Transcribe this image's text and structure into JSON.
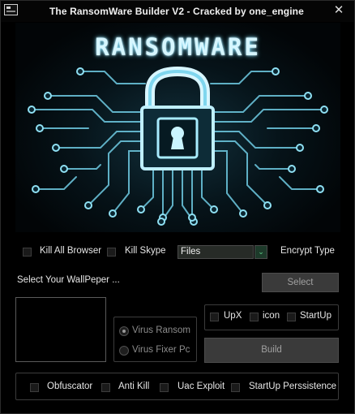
{
  "window": {
    "title": "The RansomWare Builder V2 - Cracked by one_engine",
    "close_glyph": "✕"
  },
  "banner": {
    "title": "RANSOMWARE"
  },
  "options_row": {
    "kill_all_browser": "Kill All Browser",
    "kill_skype": "Kill Skype",
    "file_type_value": "Files",
    "dropdown_arrow": "⌄",
    "encrypt_type": "Encrypt Type"
  },
  "wallpaper": {
    "label": "Select Your WallPeper ...",
    "select_button": "Select"
  },
  "mode": {
    "virus_ransom": "Virus Ransom",
    "virus_fixer": "Virus Fixer Pc",
    "selected": "Virus Ransom"
  },
  "packing": {
    "upx": "UpX",
    "icon": "icon",
    "startup": "StartUp"
  },
  "build_button": "Build",
  "bottom_options": {
    "obfuscator": "Obfuscator",
    "anti_kill": "Anti Kill",
    "uac_exploit": "Uac Exploit",
    "startup_persistence": "StartUp Perssistence"
  },
  "colors": {
    "background": "#000000",
    "circuit": "#7fd6ee",
    "dropdown_accent": "#5fd28a",
    "button_bg": "#3a3a3a"
  },
  "icons": {
    "app": "app-window-icon",
    "banner": "padlock-circuit-icon"
  }
}
